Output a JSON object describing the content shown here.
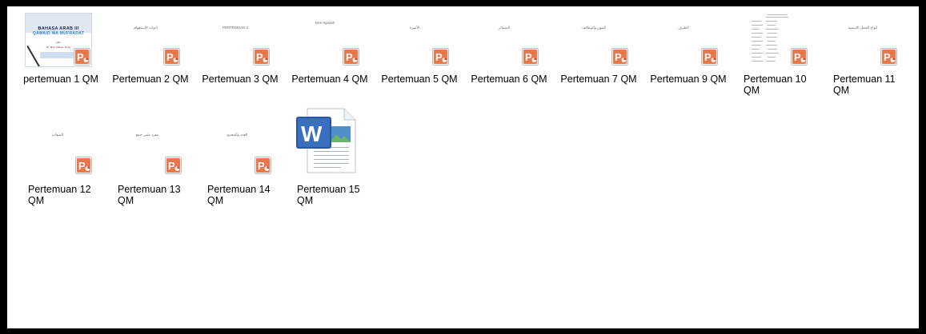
{
  "files": [
    {
      "label": "pertemuan 1 QM",
      "caption": "",
      "thumb": "title-slide",
      "slide": {
        "line1": "BAHASA ARAB III",
        "line2": "QAWAID WA MUFRADAT",
        "sub1": "oleh",
        "sub2": "Dr. Moh. Fikhan, M.Ag",
        "sub3": ""
      }
    },
    {
      "label": "Pertemuan 2 QM",
      "caption": "أدوات الإستفهام",
      "thumb": "ppt"
    },
    {
      "label": "Pertemuan 3 QM",
      "caption": "PERTEMUAN 3",
      "thumb": "ppt"
    },
    {
      "label": "Pertemuan 4 QM",
      "caption": "Isim Isyarah",
      "thumb": "ppt"
    },
    {
      "label": "Pertemuan 5 QM",
      "caption": "الأسرة",
      "thumb": "ppt"
    },
    {
      "label": "Pertemuan 6 QM",
      "caption": "الضمائر",
      "thumb": "ppt"
    },
    {
      "label": "Pertemuan 7 QM",
      "caption": "المهن والوظائف",
      "thumb": "ppt"
    },
    {
      "label": "Pertemuan 9 QM",
      "caption": "الظرف",
      "thumb": "ppt"
    },
    {
      "label": "Pertemuan 10 QM",
      "caption": "",
      "thumb": "doc-preview"
    },
    {
      "label": "Pertemuan 11 QM",
      "caption": "أنواع الجمل الإسمية",
      "thumb": "ppt"
    },
    {
      "label": "Pertemuan 12 QM",
      "caption": "الصفات",
      "thumb": "ppt"
    },
    {
      "label": "Pertemuan 13 QM",
      "caption": "مفرد مثنى جمع",
      "thumb": "ppt"
    },
    {
      "label": "Pertemuan 14 QM",
      "caption": "العدد والمعدود",
      "thumb": "ppt"
    },
    {
      "label": "Pertemuan 15 QM",
      "caption": "",
      "thumb": "word"
    }
  ],
  "icons": {
    "powerpoint": "powerpoint-icon",
    "word": "word-document-icon"
  },
  "colors": {
    "ppt_orange": "#d24726",
    "word_blue": "#2b579a",
    "selection": "#e5f3ff"
  }
}
